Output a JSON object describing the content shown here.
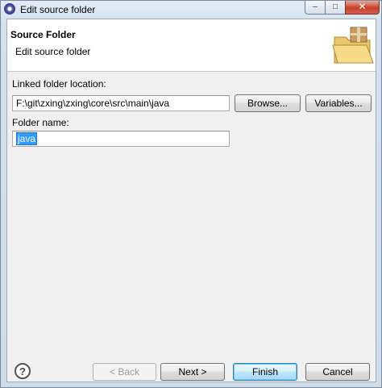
{
  "window": {
    "title": "Edit source folder",
    "controls": {
      "minimize": "–",
      "maximize": "□",
      "close": "✕"
    }
  },
  "banner": {
    "title": "Source Folder",
    "subtitle": "Edit source folder",
    "icon": "folder-package-icon"
  },
  "form": {
    "linked_location_label": "Linked folder location:",
    "linked_location_value": "F:\\git\\zxing\\zxing\\core\\src\\main\\java",
    "browse_label": "Browse...",
    "variables_label": "Variables...",
    "folder_name_label": "Folder name:",
    "folder_name_value": "java"
  },
  "footer": {
    "help_icon": "?",
    "back_label": "< Back",
    "next_label": "Next >",
    "finish_label": "Finish",
    "cancel_label": "Cancel"
  }
}
